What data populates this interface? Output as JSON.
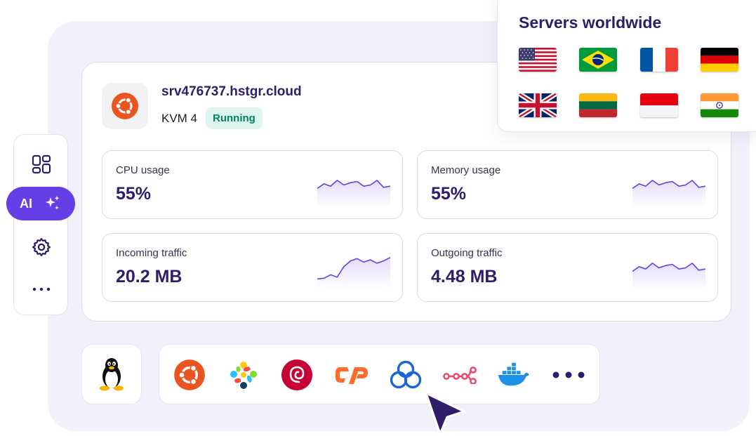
{
  "colors": {
    "brand": "#673de6",
    "heading": "#2f1c6a",
    "running_bg": "#def4f0",
    "running_text": "#008361",
    "sparkline": "#673de6"
  },
  "sidebar": {
    "items": [
      {
        "icon": "dashboard-icon"
      },
      {
        "label": "AI",
        "icon": "sparkles-icon"
      },
      {
        "icon": "gear-icon"
      },
      {
        "icon": "more-icon"
      }
    ]
  },
  "server": {
    "os_icon": "ubuntu-icon",
    "hostname": "srv476737.hstgr.cloud",
    "plan": "KVM 4",
    "status": "Running"
  },
  "metrics": [
    {
      "label": "CPU usage",
      "value": "55%",
      "trend": [
        0.35,
        0.55,
        0.45,
        0.7,
        0.5,
        0.6,
        0.65,
        0.45,
        0.5,
        0.7,
        0.4,
        0.45
      ]
    },
    {
      "label": "Memory usage",
      "value": "55%",
      "trend": [
        0.35,
        0.55,
        0.45,
        0.7,
        0.5,
        0.6,
        0.65,
        0.45,
        0.5,
        0.7,
        0.4,
        0.45
      ]
    },
    {
      "label": "Incoming traffic",
      "value": "20.2 MB",
      "trend": [
        0.02,
        0.05,
        0.2,
        0.1,
        0.55,
        0.8,
        0.9,
        0.75,
        0.85,
        0.7,
        0.8,
        0.95
      ]
    },
    {
      "label": "Outgoing traffic",
      "value": "4.48 MB",
      "trend": [
        0.35,
        0.55,
        0.45,
        0.7,
        0.5,
        0.6,
        0.65,
        0.45,
        0.5,
        0.7,
        0.4,
        0.45
      ]
    }
  ],
  "worldwide": {
    "title": "Servers worldwide",
    "flags": [
      "us-flag",
      "brazil-flag",
      "france-flag",
      "germany-flag",
      "uk-flag",
      "lithuania-flag",
      "indonesia-flag",
      "india-flag"
    ]
  },
  "os_tiles": {
    "selected": "linux-tux-icon",
    "apps": [
      "ubuntu-icon",
      "almalinux-icon",
      "debian-icon",
      "cpanel-icon",
      "cloudpanel-icon",
      "n8n-icon",
      "docker-icon",
      "more-icon"
    ]
  }
}
